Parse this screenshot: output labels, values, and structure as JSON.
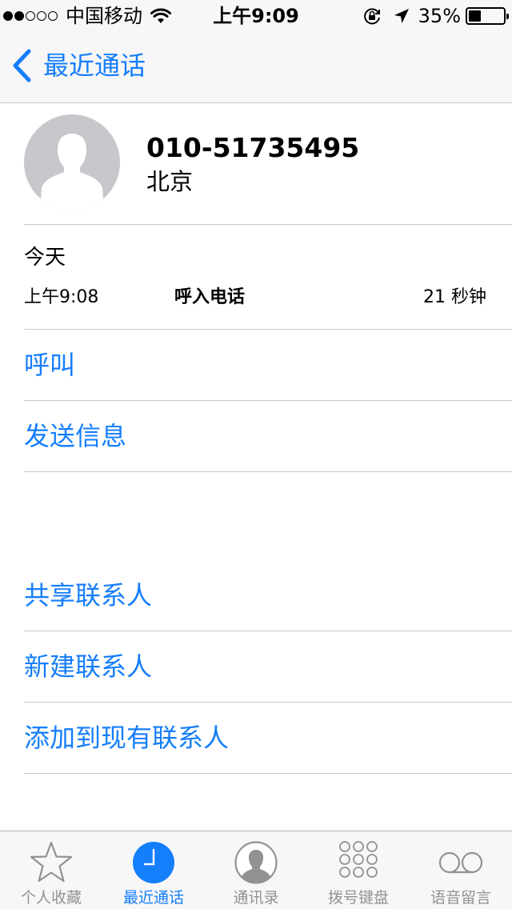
{
  "status_bar": {
    "carrier": "中国移动",
    "time": "上午9:09",
    "battery_percent": "35%",
    "battery_level": 0.35,
    "signal_bars": 2,
    "signal_total": 5
  },
  "nav": {
    "back_label": "最近通话"
  },
  "contact": {
    "phone_number": "010-51735495",
    "location": "北京"
  },
  "call_log": {
    "day": "今天",
    "time": "上午9:08",
    "type": "呼入电话",
    "duration": "21 秒钟"
  },
  "actions": {
    "call": "呼叫",
    "send_message": "发送信息",
    "share_contact": "共享联系人",
    "new_contact": "新建联系人",
    "add_to_existing": "添加到现有联系人"
  },
  "tabs": [
    {
      "label": "个人收藏",
      "icon": "star-icon",
      "active": false
    },
    {
      "label": "最近通话",
      "icon": "clock-icon",
      "active": true
    },
    {
      "label": "通讯录",
      "icon": "contacts-icon",
      "active": false
    },
    {
      "label": "拨号键盘",
      "icon": "keypad-icon",
      "active": false
    },
    {
      "label": "语音留言",
      "icon": "voicemail-icon",
      "active": false
    }
  ],
  "colors": {
    "accent": "#157efb",
    "inactive": "#929292",
    "bar_background": "#f7f7f7",
    "separator": "#c8c7cc",
    "avatar": "#c7c7cc"
  }
}
